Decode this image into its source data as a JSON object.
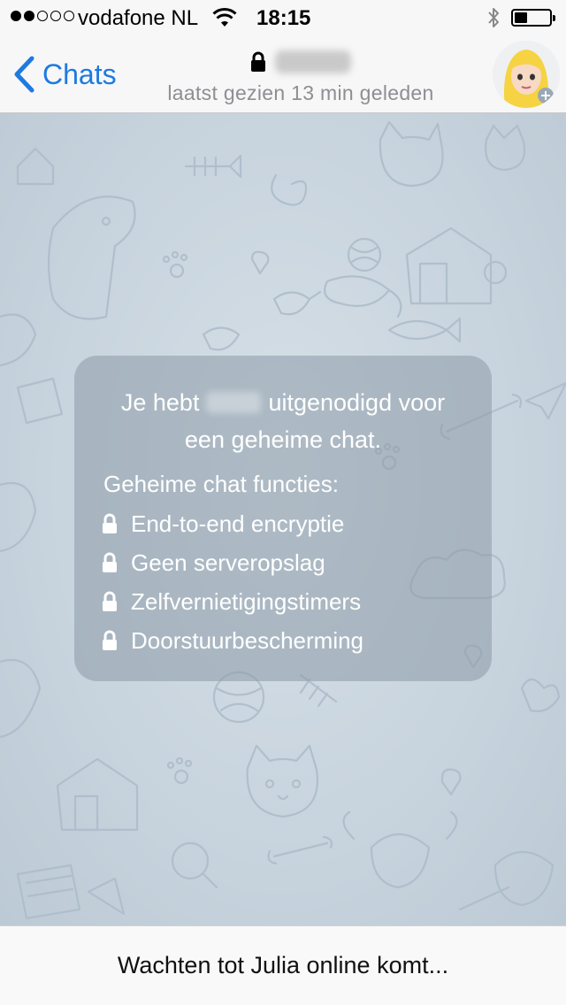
{
  "status_bar": {
    "carrier": "vodafone NL",
    "time": "18:15",
    "signal_bars_filled": 2,
    "signal_bars_total": 5,
    "battery_level": 0.3
  },
  "nav": {
    "back_label": "Chats",
    "subtitle": "laatst gezien 13 min geleden",
    "accent_color": "#1e7ae0"
  },
  "card": {
    "line1_before": "Je hebt",
    "line1_after": "uitgenodigd voor",
    "line2": "een geheime chat.",
    "features_title": "Geheime chat functies:",
    "features": [
      "End-to-end encryptie",
      "Geen serveropslag",
      "Zelfvernietigingstimers",
      "Doorstuurbescherming"
    ]
  },
  "bottom": {
    "waiting_text": "Wachten tot Julia online komt..."
  }
}
